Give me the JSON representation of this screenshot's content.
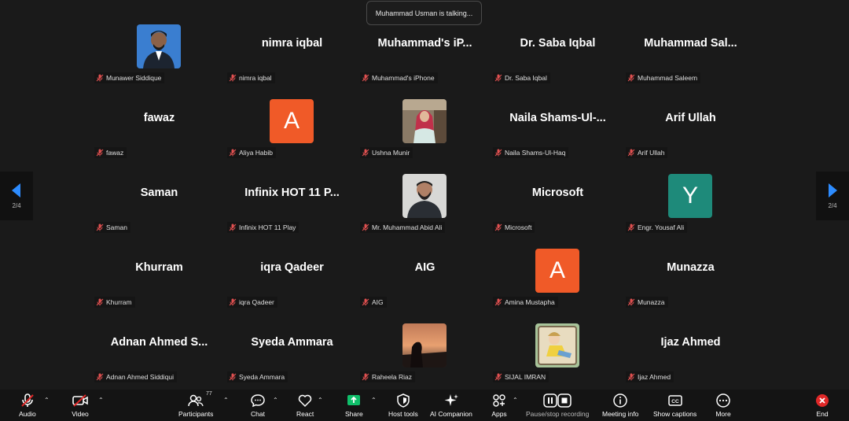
{
  "status": {
    "talking": "Muhammad Usman is talking..."
  },
  "nav": {
    "left_page": "2/4",
    "right_page": "2/4"
  },
  "tiles": [
    {
      "name": "",
      "label": "Munawer Siddique",
      "avatar": "photo-man-blue"
    },
    {
      "name": "nimra iqbal",
      "label": "nimra iqbal"
    },
    {
      "name": "Muhammad's  iP...",
      "label": "Muhammad's iPhone"
    },
    {
      "name": "Dr. Saba Iqbal",
      "label": "Dr. Saba Iqbal"
    },
    {
      "name": "Muhammad  Sal...",
      "label": "Muhammad Saleem"
    },
    {
      "name": "fawaz",
      "label": "fawaz"
    },
    {
      "name": "",
      "label": "Aliya Habib",
      "avatar_letter": "A",
      "avatar_color": "#f05a28"
    },
    {
      "name": "",
      "label": "Ushna Munir",
      "avatar": "photo-woman-hijab"
    },
    {
      "name": "Naila  Shams-Ul-...",
      "label": "Naila Shams-Ul-Haq"
    },
    {
      "name": "Arif Ullah",
      "label": "Arif Ullah"
    },
    {
      "name": "Saman",
      "label": "Saman"
    },
    {
      "name": "Infinix  HOT  11  P...",
      "label": "Infinix HOT 11 Play"
    },
    {
      "name": "",
      "label": "Mr. Muhammad Abid Ali",
      "avatar": "photo-man-beard"
    },
    {
      "name": "Microsoft",
      "label": "Microsoft"
    },
    {
      "name": "",
      "label": "Engr. Yousaf Ali",
      "avatar_letter": "Y",
      "avatar_color": "#1e8a7a"
    },
    {
      "name": "Khurram",
      "label": "Khurram"
    },
    {
      "name": "iqra Qadeer",
      "label": "iqra Qadeer"
    },
    {
      "name": "AIG",
      "label": "AIG"
    },
    {
      "name": "",
      "label": "Amina Mustapha",
      "avatar_letter": "A",
      "avatar_color": "#f05a28"
    },
    {
      "name": "Munazza",
      "label": "Munazza"
    },
    {
      "name": "Adnan  Ahmed  S...",
      "label": "Adnan Ahmed Siddiqui"
    },
    {
      "name": "Syeda Ammara",
      "label": "Syeda Ammara"
    },
    {
      "name": "",
      "label": "Raheela Riaz",
      "avatar": "photo-sunset"
    },
    {
      "name": "",
      "label": "SIJAL IMRAN",
      "avatar": "photo-cartoon"
    },
    {
      "name": "Ijaz Ahmed",
      "label": "Ijaz Ahmed"
    }
  ],
  "toolbar": {
    "audio": "Audio",
    "video": "Video",
    "participants": "Participants",
    "participants_count": "77",
    "chat": "Chat",
    "react": "React",
    "share": "Share",
    "host_tools": "Host tools",
    "ai_companion": "AI Companion",
    "apps": "Apps",
    "record": "Pause/stop recording",
    "meeting_info": "Meeting info",
    "captions": "Show captions",
    "more": "More",
    "end": "End"
  },
  "colors": {
    "accent_share": "#0fbf6a",
    "end_red": "#e02828",
    "mic_off_red": "#e05050",
    "nav_arrow": "#2d8cff"
  }
}
